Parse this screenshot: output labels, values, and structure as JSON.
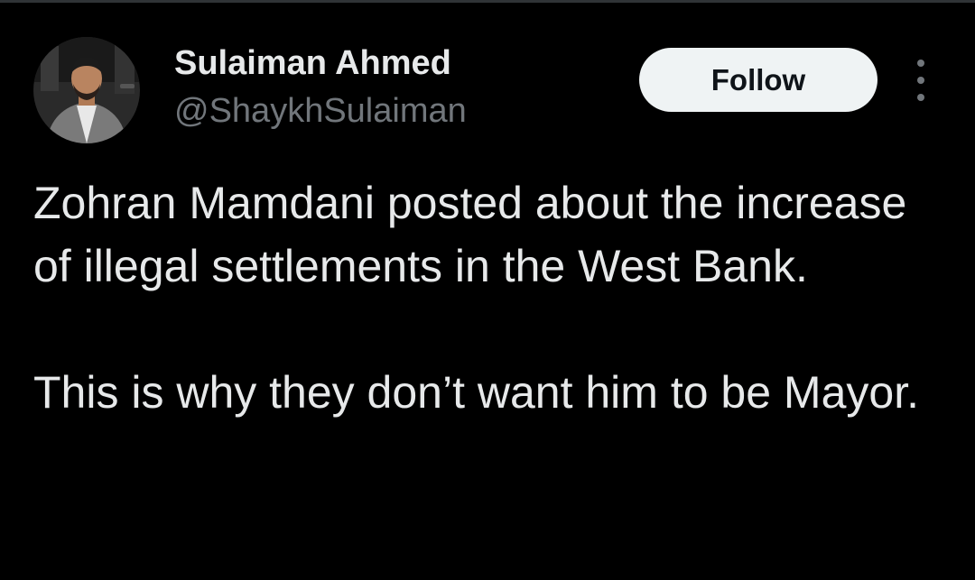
{
  "author": {
    "name": "Sulaiman Ahmed",
    "handle": "@ShaykhSulaiman",
    "avatar_icon": "profile-photo-icon"
  },
  "actions": {
    "follow_label": "Follow",
    "more_icon": "more-vertical-icon"
  },
  "tweet": {
    "paragraphs": [
      "Zohran Mamdani posted about the increase of illegal settlements in the West Bank.",
      "This is why they don’t want him to be Mayor."
    ]
  },
  "colors": {
    "background": "#000000",
    "text_primary": "#e7e9ea",
    "text_secondary": "#71767b",
    "button_bg": "#eff3f4",
    "button_text": "#0f1419"
  }
}
